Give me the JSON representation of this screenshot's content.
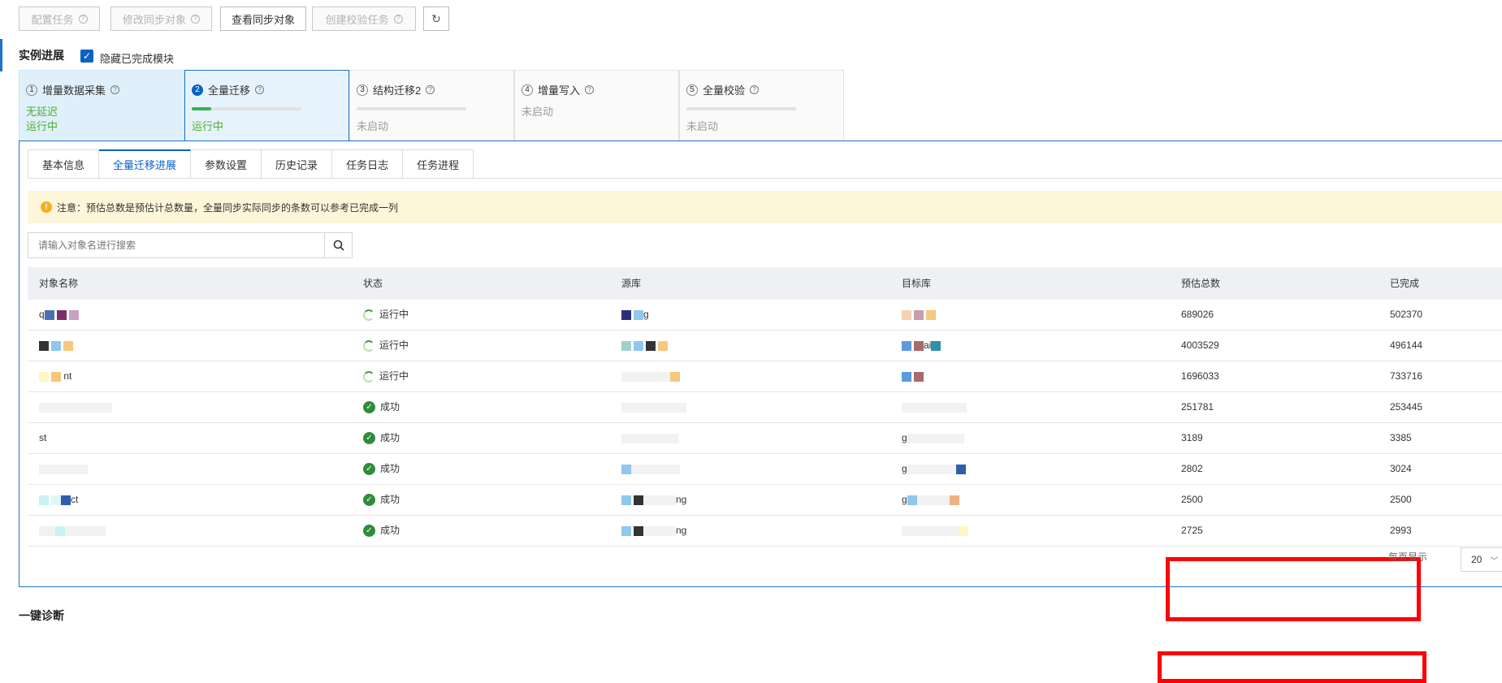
{
  "toolbar": {
    "config_task": "配置任务",
    "modify_objects": "修改同步对象",
    "view_objects": "查看同步对象",
    "create_check": "创建校验任务"
  },
  "section": {
    "title": "实例进展",
    "hide_done_label": "隐藏已完成模块"
  },
  "steps": [
    {
      "num": "1",
      "label": "增量数据采集",
      "line1": "无延迟",
      "line2": "运行中"
    },
    {
      "num": "2",
      "label": "全量迁移",
      "line1": "",
      "line2": "运行中",
      "progress": 0.18
    },
    {
      "num": "3",
      "label": "结构迁移2",
      "line1": "",
      "line2": "未启动",
      "progress": 0
    },
    {
      "num": "4",
      "label": "增量写入",
      "line1": "未启动",
      "line2": ""
    },
    {
      "num": "5",
      "label": "全量校验",
      "line1": "",
      "line2": "未启动",
      "progress": 0
    }
  ],
  "tabs": [
    "基本信息",
    "全量迁移进展",
    "参数设置",
    "历史记录",
    "任务日志",
    "任务进程"
  ],
  "notice": "注意：预估总数是预估计总数量，全量同步实际同步的条数可以参考已完成一列",
  "search": {
    "placeholder": "请输入对象名进行搜索"
  },
  "table": {
    "headers": [
      "对象名称",
      "状态",
      "源库",
      "目标库",
      "预估总数",
      "已完成"
    ],
    "rows": [
      {
        "name": "q",
        "status": "运行中",
        "src": "g",
        "dst": "",
        "estimated": "689026",
        "done": "502370"
      },
      {
        "name": "",
        "status": "运行中",
        "src": "",
        "dst": "ai",
        "estimated": "4003529",
        "done": "496144"
      },
      {
        "name": "nt",
        "status": "运行中",
        "src": "",
        "dst": "",
        "estimated": "1696033",
        "done": "733716"
      },
      {
        "name": "",
        "status": "成功",
        "src": "",
        "dst": "",
        "estimated": "251781",
        "done": "253445"
      },
      {
        "name": "st",
        "status": "成功",
        "src": "",
        "dst": "g",
        "estimated": "3189",
        "done": "3385"
      },
      {
        "name": "",
        "status": "成功",
        "src": "",
        "dst": "g",
        "estimated": "2802",
        "done": "3024"
      },
      {
        "name": "ct",
        "status": "成功",
        "src": "ng",
        "dst": "g",
        "estimated": "2500",
        "done": "2500"
      },
      {
        "name": "",
        "status": "成功",
        "src": "ng",
        "dst": "",
        "estimated": "2725",
        "done": "2993"
      }
    ]
  },
  "pager": {
    "label": "每页显示",
    "size": "20"
  },
  "bottom_title": "一键诊断",
  "colors": {
    "accent": "#0b62c4",
    "highlight": "#ff0000",
    "success": "#2e8d39",
    "running": "#4cae2a"
  }
}
